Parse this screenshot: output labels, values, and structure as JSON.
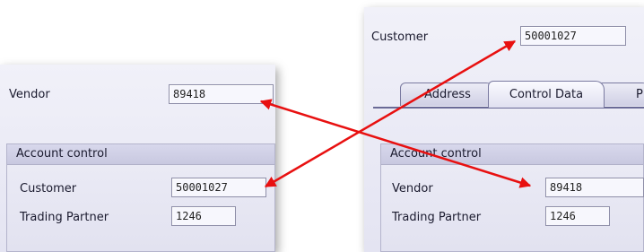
{
  "left_panel": {
    "vendor_label": "Vendor",
    "vendor_value": "89418",
    "group_title": "Account control",
    "customer_label": "Customer",
    "customer_value": "50001027",
    "trading_partner_label": "Trading Partner",
    "trading_partner_value": "1246"
  },
  "right_panel": {
    "customer_label": "Customer",
    "customer_value": "50001027",
    "tabs": [
      {
        "label": "Address"
      },
      {
        "label": "Control Data"
      },
      {
        "label": "P"
      }
    ],
    "active_tab": "Control Data",
    "group_title": "Account control",
    "vendor_label": "Vendor",
    "vendor_value": "89418",
    "trading_partner_label": "Trading Partner",
    "trading_partner_value": "1246"
  },
  "colors": {
    "arrow": "#e81010",
    "panel_bg": "#e8e8f4",
    "group_header": "#cfcfe6"
  }
}
